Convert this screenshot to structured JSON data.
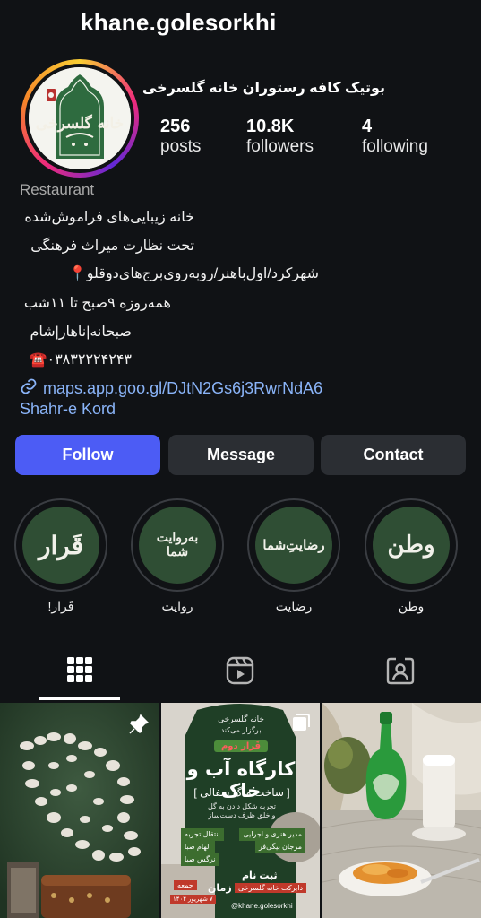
{
  "profile": {
    "username": "khane.golesorkhi",
    "full_name": "بوتیک کافه رستوران خانه گلسرخی",
    "avatar_logo_text": "خانه گلسرخی",
    "stats": {
      "posts": {
        "value": "256",
        "label": "posts"
      },
      "followers": {
        "value": "10.8K",
        "label": "followers"
      },
      "following": {
        "value": "4",
        "label": "following"
      }
    },
    "category": "Restaurant",
    "bio_lines": [
      "خانه زیبایی‌های فراموش‌شده",
      "تحت نظارت میراث فرهنگی",
      "شهرکرد/اول‌باهنر/روبه‌روی‌برج‌های‌دوقلو📍",
      "همه‌روزه ۹صبح تا ۱۱شب",
      "صبحانه|ناهار|شام",
      "۰۳۸۳۲۲۲۴۲۴۳☎️"
    ],
    "link": "maps.app.goo.gl/DJtN2Gs6j3RwrNdA6",
    "location": "Shahr-e Kord"
  },
  "buttons": {
    "follow": "Follow",
    "message": "Message",
    "contact": "Contact"
  },
  "highlights": [
    {
      "cover_text": "قَرار",
      "label": "قَرار!"
    },
    {
      "cover_text": "به‌روایت شما",
      "label": "روایت"
    },
    {
      "cover_text": "رضایتِ‌شما",
      "label": "رضایت"
    },
    {
      "cover_text": "وطن",
      "label": "وطن"
    }
  ],
  "tabs": [
    {
      "name": "posts-grid",
      "icon": "grid-icon",
      "active": true
    },
    {
      "name": "reels",
      "icon": "reels-icon",
      "active": false
    },
    {
      "name": "tagged",
      "icon": "tagged-person-icon",
      "active": false
    }
  ],
  "grid": {
    "post1": {
      "icon": "pin-icon"
    },
    "post2": {
      "icon": "multi-post-icon",
      "lines": [
        "خانه گلسرخی",
        "برگزار می‌کند",
        "قَرار دوم",
        "کارگاه آب و خاک",
        "[ ساخت ماگ سفالی ]",
        "تجربه شکل دادن به گل",
        "و خلق ظرف دست‌ساز",
        "مدیر هنری و اجرایی",
        "مرجان بیگی‌فر",
        "انتقال تجربه",
        "الهام صبا",
        "نرگس صبا",
        "ثبت نام",
        "دایرکت خانه گلسرخی",
        "زمان",
        "جمعه",
        "۷ شهریور ۱۴۰۴",
        "@khane.golesorkhi"
      ]
    },
    "post3": {}
  },
  "colors": {
    "background": "#101215",
    "follow_button": "#4c5cf5",
    "secondary_button": "#2b2e33",
    "link": "#8ab4f8",
    "highlight_green": "#2f4e34"
  }
}
